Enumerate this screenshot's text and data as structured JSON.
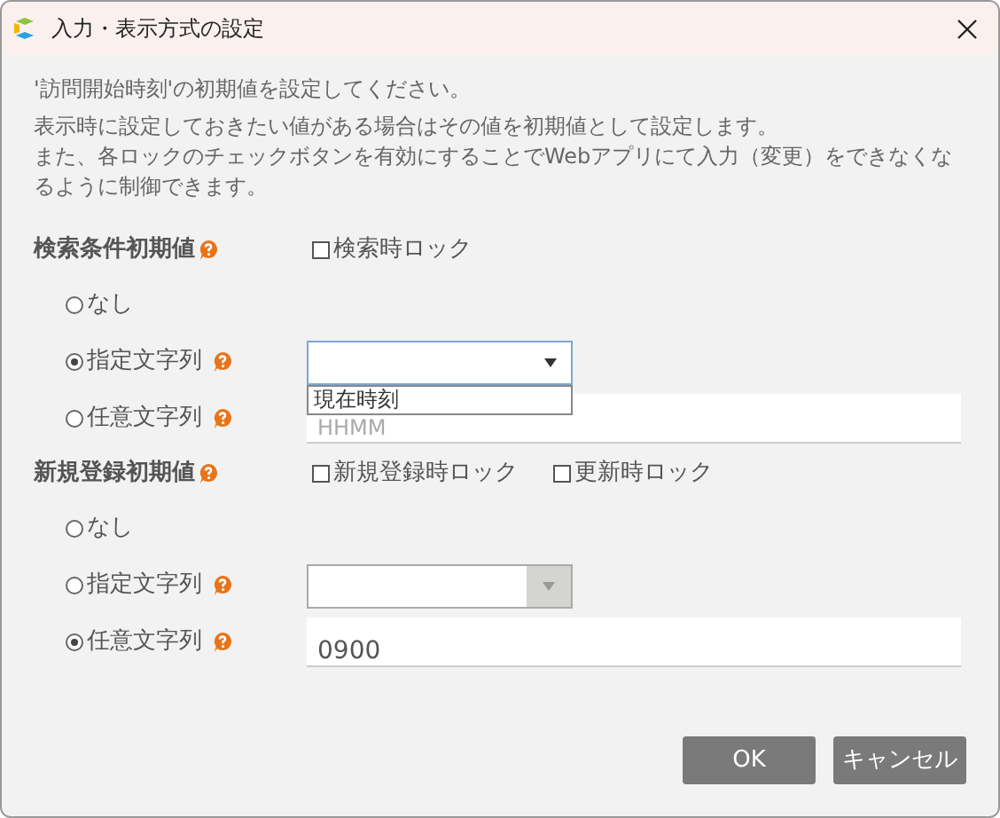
{
  "window": {
    "title": "入力・表示方式の設定"
  },
  "intro": [
    "'訪問開始時刻'の初期値を設定してください。",
    "表示時に設定しておきたい値がある場合はその値を初期値として設定します。",
    "また、各ロックのチェックボタンを有効にすることでWebアプリにて入力（変更）をできなくなるように制御できます。"
  ],
  "sections": [
    {
      "label": "検索条件初期値",
      "checkboxes": [
        {
          "label": "検索時ロック",
          "checked": false
        }
      ],
      "options": [
        {
          "label": "なし",
          "selected": false
        },
        {
          "label": "指定文字列",
          "selected": true,
          "control": {
            "kind": "select",
            "expanded": true,
            "disabled": false,
            "menu_items": [
              "現在時刻"
            ]
          }
        },
        {
          "label": "任意文字列",
          "selected": false,
          "control": {
            "kind": "text",
            "placeholder": "HHMM"
          }
        }
      ]
    },
    {
      "label": "新規登録初期値",
      "checkboxes": [
        {
          "label": "新規登録時ロック",
          "checked": false
        },
        {
          "label": "更新時ロック",
          "checked": false
        }
      ],
      "options": [
        {
          "label": "なし",
          "selected": false
        },
        {
          "label": "指定文字列",
          "selected": false,
          "control": {
            "kind": "select",
            "expanded": false,
            "disabled": true
          }
        },
        {
          "label": "任意文字列",
          "selected": true,
          "control": {
            "kind": "text",
            "value": "0900"
          }
        }
      ]
    }
  ],
  "buttons": [
    "OK",
    "キャンセル"
  ]
}
